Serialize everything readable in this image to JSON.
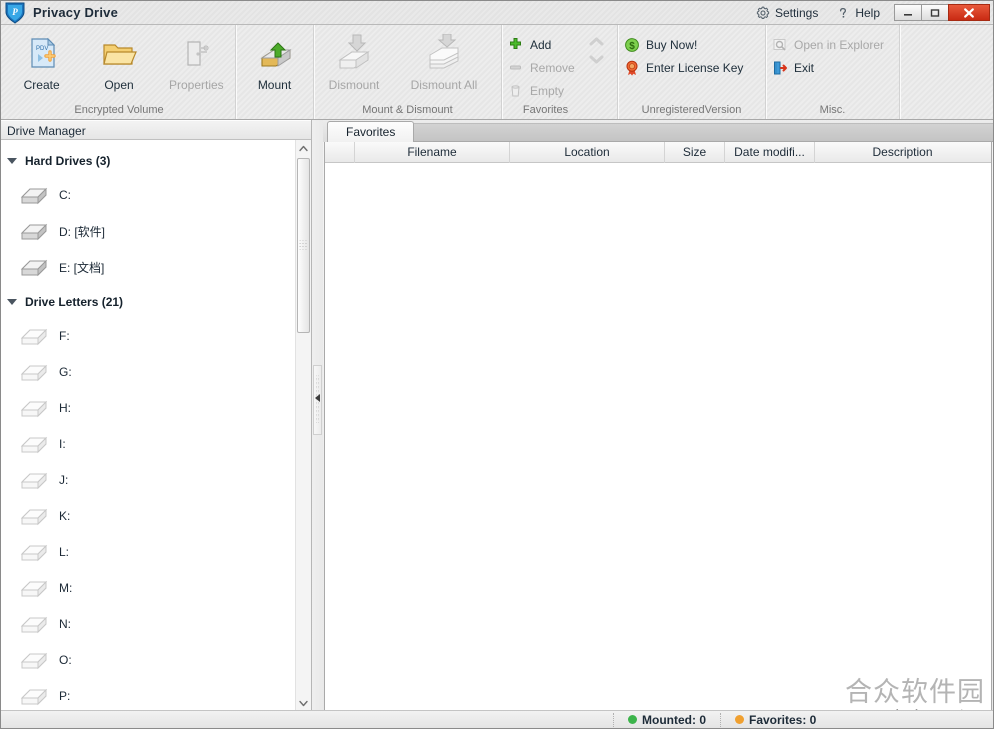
{
  "window": {
    "title": "Privacy Drive",
    "controls": {
      "minimize": "–",
      "maximize": "□",
      "close": "✕"
    }
  },
  "titlebar_links": [
    {
      "label": "Settings",
      "icon": "gear-icon"
    },
    {
      "label": "Help",
      "icon": "question-mark-icon"
    }
  ],
  "ribbon": {
    "groups": [
      {
        "name": "encrypted-volume",
        "label": "Encrypted Volume",
        "buttons": [
          {
            "label": "Create",
            "icon": "new-document-icon",
            "enabled": true
          },
          {
            "label": "Open",
            "icon": "folder-open-icon",
            "enabled": true
          },
          {
            "label": "Properties",
            "icon": "properties-icon",
            "enabled": false
          }
        ]
      },
      {
        "name": "mount",
        "label": "",
        "buttons": [
          {
            "label": "Mount",
            "icon": "mount-drive-icon",
            "enabled": true
          }
        ]
      },
      {
        "name": "mount-dismount",
        "label": "Mount & Dismount",
        "buttons": [
          {
            "label": "Dismount",
            "icon": "dismount-drive-icon",
            "enabled": false
          },
          {
            "label": "Dismount All",
            "icon": "dismount-all-icon",
            "enabled": false
          }
        ]
      },
      {
        "name": "favorites",
        "label": "Favorites",
        "buttons": [
          {
            "label": "Add",
            "icon": "plus-icon",
            "enabled": true
          },
          {
            "label": "Remove",
            "icon": "minus-icon",
            "enabled": false
          },
          {
            "label": "Empty",
            "icon": "trash-icon",
            "enabled": false
          }
        ],
        "arrows": [
          {
            "icon": "chevron-up-icon",
            "enabled": false
          },
          {
            "icon": "chevron-down-icon",
            "enabled": false
          }
        ]
      },
      {
        "name": "unregistered-version",
        "label": "UnregisteredVersion",
        "buttons": [
          {
            "label": "Buy Now!",
            "icon": "dollar-icon",
            "enabled": true
          },
          {
            "label": "Enter License Key",
            "icon": "award-ribbon-icon",
            "enabled": true
          }
        ]
      },
      {
        "name": "misc",
        "label": "Misc.",
        "buttons": [
          {
            "label": "Open in Explorer",
            "icon": "magnifier-icon",
            "enabled": false
          },
          {
            "label": "Exit",
            "icon": "exit-door-icon",
            "enabled": true
          }
        ]
      }
    ]
  },
  "left_pane": {
    "header": "Drive Manager",
    "groups": [
      {
        "label": "Hard Drives (3)",
        "items": [
          {
            "label": "C:"
          },
          {
            "label": "D: [软件]"
          },
          {
            "label": "E: [文档]"
          }
        ]
      },
      {
        "label": "Drive Letters (21)",
        "items": [
          {
            "label": "F:"
          },
          {
            "label": "G:"
          },
          {
            "label": "H:"
          },
          {
            "label": "I:"
          },
          {
            "label": "J:"
          },
          {
            "label": "K:"
          },
          {
            "label": "L:"
          },
          {
            "label": "M:"
          },
          {
            "label": "N:"
          },
          {
            "label": "O:"
          },
          {
            "label": "P:"
          }
        ]
      }
    ]
  },
  "right_pane": {
    "tabs": [
      {
        "label": "Favorites",
        "active": true
      }
    ],
    "columns": [
      {
        "label": "",
        "width": 30
      },
      {
        "label": "Filename",
        "width": 155
      },
      {
        "label": "Location",
        "width": 155
      },
      {
        "label": "Size",
        "width": 60
      },
      {
        "label": "Date modifi...",
        "width": 90
      },
      {
        "label": "Description",
        "width": 175
      }
    ],
    "rows": []
  },
  "statusbar": {
    "items": [
      {
        "label": "Mounted: 0",
        "color": "#3cb44b"
      },
      {
        "label": "Favorites: 0",
        "color": "#f0a030"
      }
    ]
  },
  "watermark": {
    "cn": "合众软件园",
    "url": "www.hezhong.net"
  },
  "colors": {
    "accent": "#1e6fb8",
    "close_button": "#c92a13",
    "green": "#3cb44b",
    "gold": "#e0a83a"
  }
}
